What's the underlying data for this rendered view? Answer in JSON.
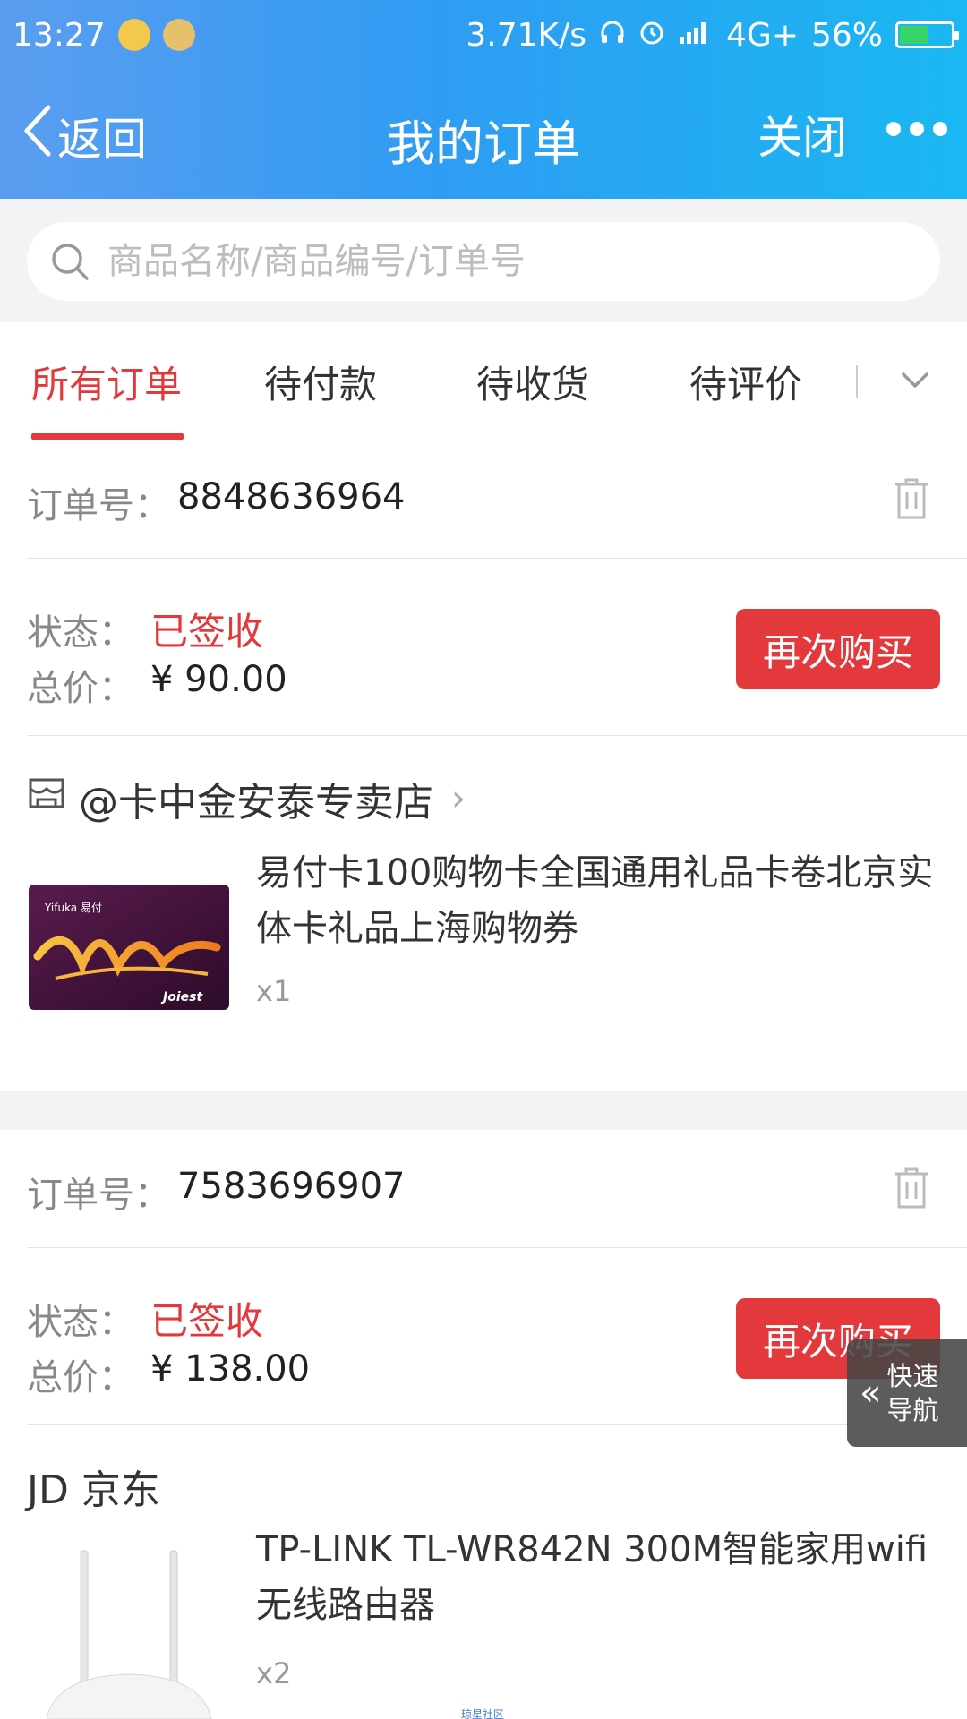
{
  "status_bar": {
    "time": "13:27",
    "net_speed": "3.71K/s",
    "network": "4G+",
    "battery": "56%",
    "battery_level": 0.56
  },
  "nav": {
    "back_label": "返回",
    "title": "我的订单",
    "close_label": "关闭"
  },
  "search": {
    "placeholder": "商品名称/商品编号/订单号"
  },
  "tabs": [
    {
      "label": "所有订单",
      "active": true
    },
    {
      "label": "待付款",
      "active": false
    },
    {
      "label": "待收货",
      "active": false
    },
    {
      "label": "待评价",
      "active": false
    }
  ],
  "orders": [
    {
      "order_label": "订单号：",
      "order_no": "8848636964",
      "status_label": "状态：",
      "status": "已签收",
      "total_label": "总价：",
      "total": "¥ 90.00",
      "button": "再次购买",
      "shop": "@卡中金安泰专卖店",
      "product_title": "易付卡100购物卡全国通用礼品卡卷北京实体卡礼品上海购物券",
      "qty": "x1"
    },
    {
      "order_label": "订单号：",
      "order_no": "7583696907",
      "status_label": "状态：",
      "status": "已签收",
      "total_label": "总价：",
      "total": "¥ 138.00",
      "button": "再次购买",
      "shop": "JD 京东",
      "product_title": "TP-LINK TL-WR842N 300M智能家用wifi无线路由器",
      "qty": "x2"
    }
  ],
  "quick_nav": {
    "line1": "快速",
    "line2": "导航"
  },
  "card_logo": {
    "brand": "Yifuka 易付",
    "maker": "Joiest"
  },
  "watermark": "琼星社区",
  "colors": {
    "accent": "#e4393c",
    "header_start": "#5b9df0",
    "header_end": "#1ab8f2"
  }
}
